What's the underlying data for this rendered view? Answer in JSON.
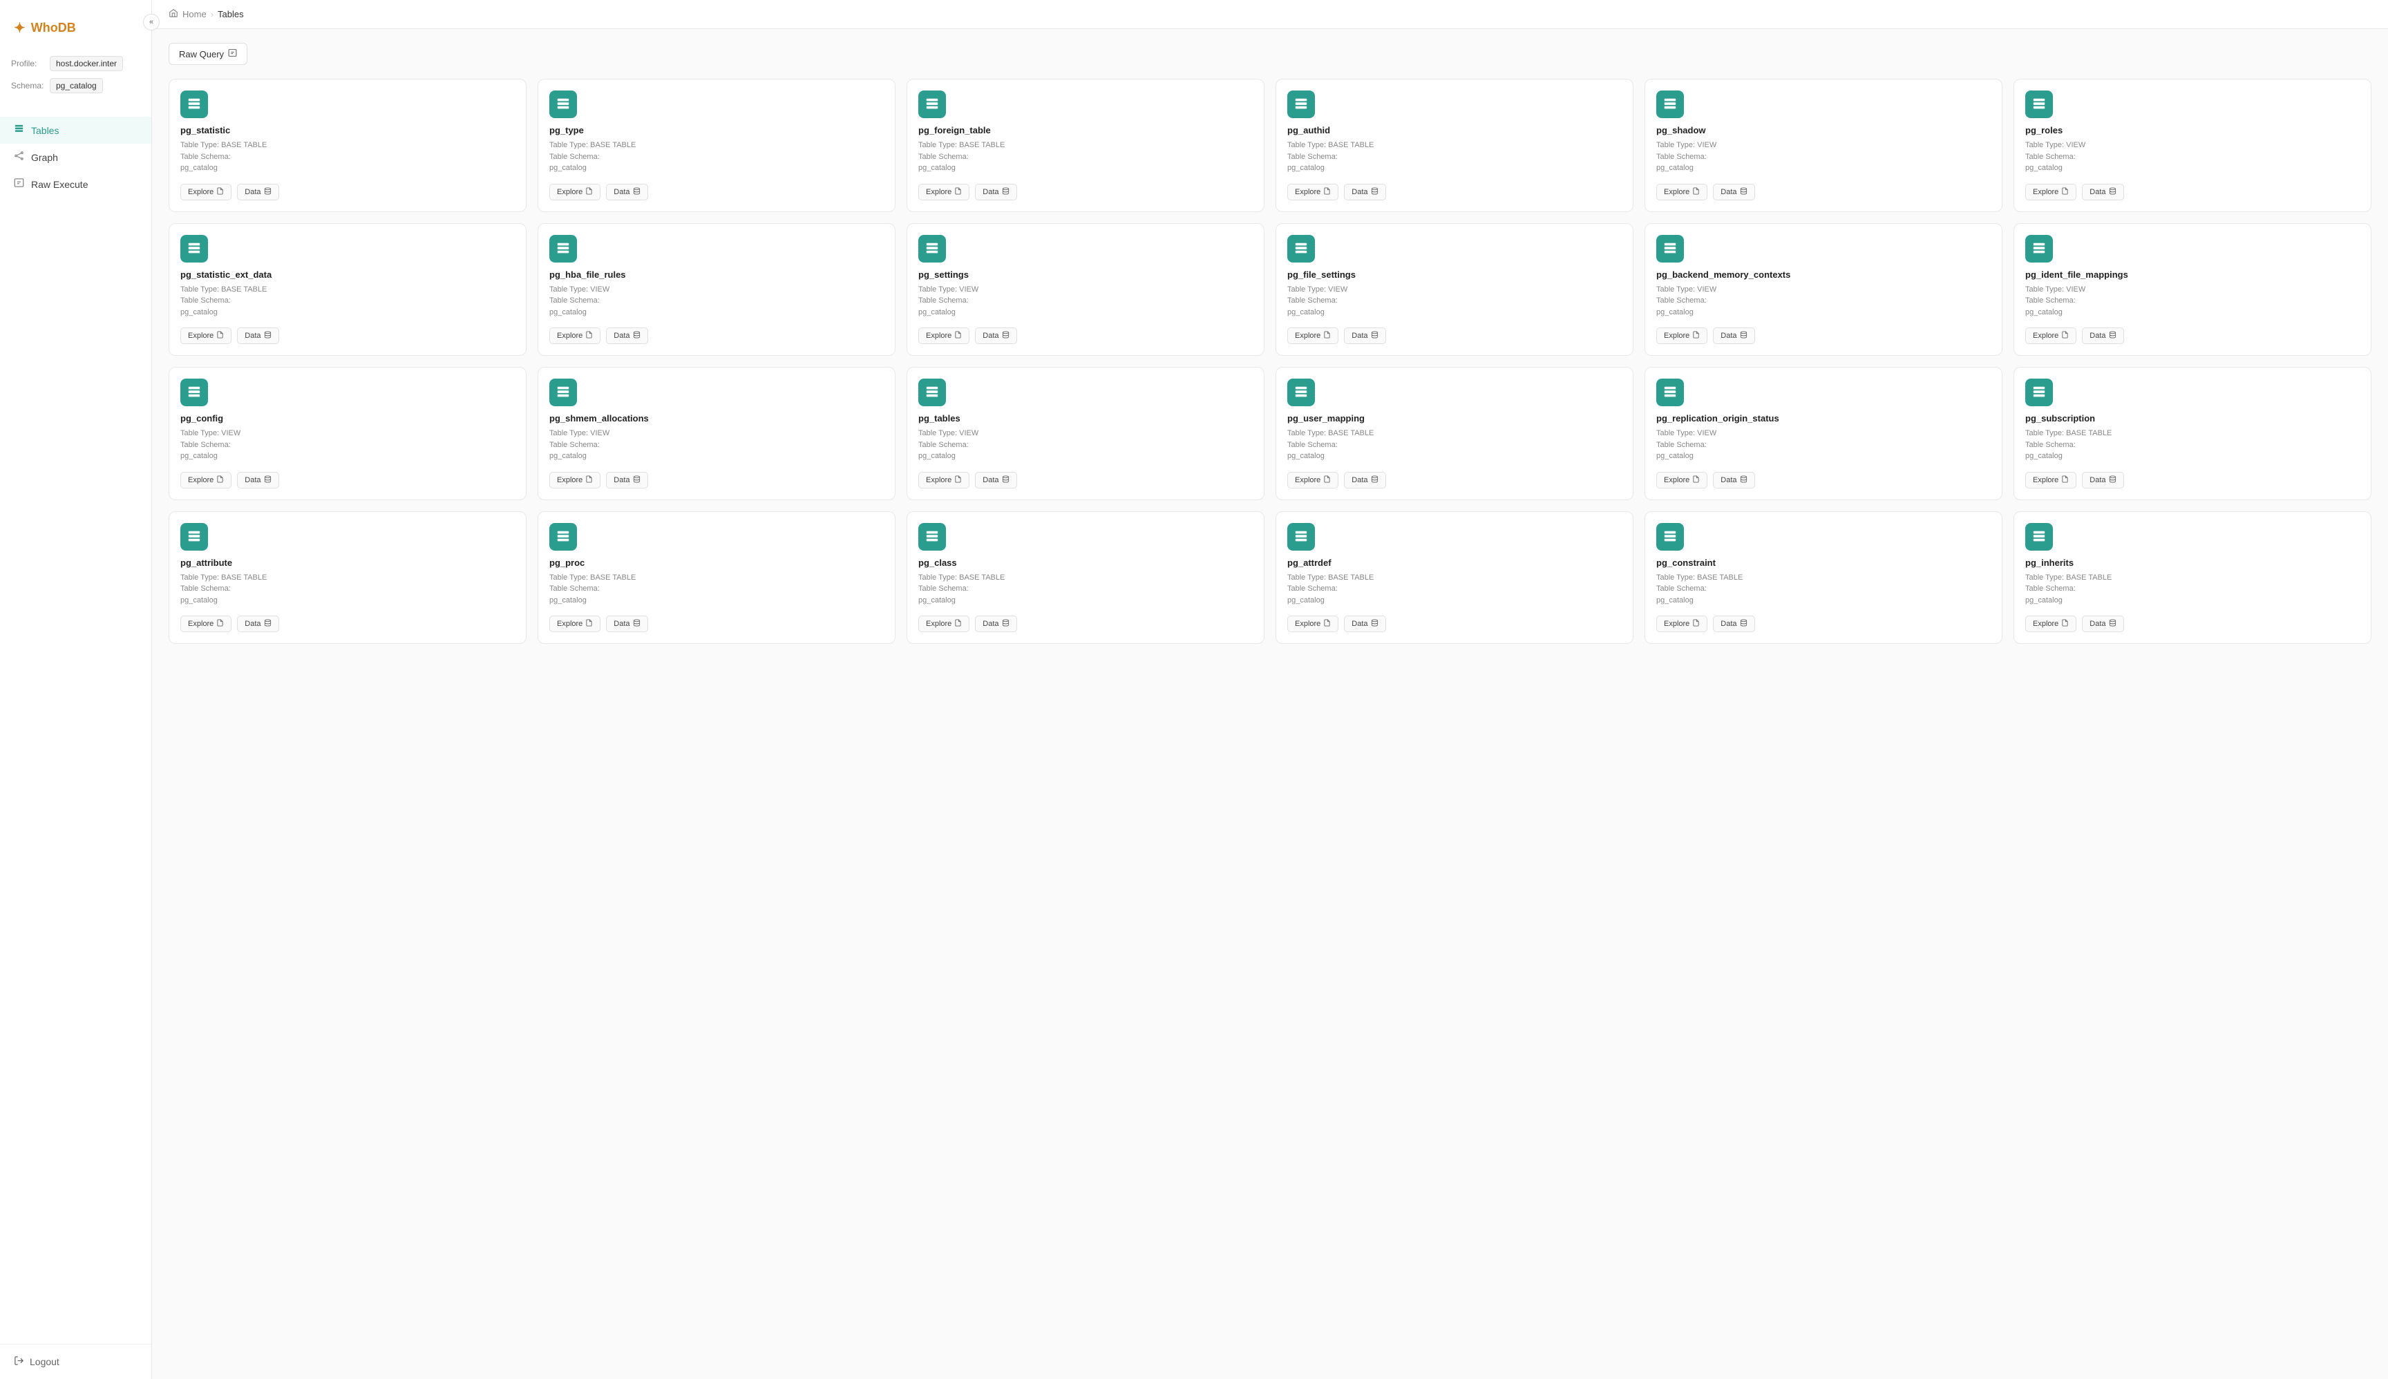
{
  "app": {
    "name": "WhoDB",
    "logo_icon": "✦"
  },
  "sidebar": {
    "profile_label": "Profile:",
    "profile_value": "host.docker.inter",
    "schema_label": "Schema:",
    "schema_value": "pg_catalog",
    "nav_items": [
      {
        "id": "tables",
        "label": "Tables",
        "icon": "table",
        "active": true
      },
      {
        "id": "graph",
        "label": "Graph",
        "icon": "graph",
        "active": false
      },
      {
        "id": "raw-execute",
        "label": "Raw Execute",
        "icon": "raw",
        "active": false
      }
    ],
    "logout_label": "Logout",
    "collapse_icon": "«"
  },
  "breadcrumb": {
    "home": "Home",
    "current": "Tables"
  },
  "toolbar": {
    "raw_query_label": "Raw Query"
  },
  "tables": [
    {
      "name": "pg_statistic",
      "type": "BASE TABLE",
      "schema": "pg_catalog"
    },
    {
      "name": "pg_type",
      "type": "BASE TABLE",
      "schema": "pg_catalog"
    },
    {
      "name": "pg_foreign_table",
      "type": "BASE TABLE",
      "schema": "pg_catalog"
    },
    {
      "name": "pg_authid",
      "type": "BASE TABLE",
      "schema": "pg_catalog"
    },
    {
      "name": "pg_shadow",
      "type": "VIEW",
      "schema": "pg_catalog"
    },
    {
      "name": "pg_roles",
      "type": "VIEW",
      "schema": "pg_catalog"
    },
    {
      "name": "pg_statistic_ext_data",
      "type": "BASE TABLE",
      "schema": "pg_catalog"
    },
    {
      "name": "pg_hba_file_rules",
      "type": "VIEW",
      "schema": "pg_catalog"
    },
    {
      "name": "pg_settings",
      "type": "VIEW",
      "schema": "pg_catalog"
    },
    {
      "name": "pg_file_settings",
      "type": "VIEW",
      "schema": "pg_catalog"
    },
    {
      "name": "pg_backend_memory_contexts",
      "type": "VIEW",
      "schema": "pg_catalog"
    },
    {
      "name": "pg_ident_file_mappings",
      "type": "VIEW",
      "schema": "pg_catalog"
    },
    {
      "name": "pg_config",
      "type": "VIEW",
      "schema": "pg_catalog"
    },
    {
      "name": "pg_shmem_allocations",
      "type": "VIEW",
      "schema": "pg_catalog"
    },
    {
      "name": "pg_tables",
      "type": "VIEW",
      "schema": "pg_catalog"
    },
    {
      "name": "pg_user_mapping",
      "type": "BASE TABLE",
      "schema": "pg_catalog"
    },
    {
      "name": "pg_replication_origin_status",
      "type": "VIEW",
      "schema": "pg_catalog"
    },
    {
      "name": "pg_subscription",
      "type": "BASE TABLE",
      "schema": "pg_catalog"
    },
    {
      "name": "pg_attribute",
      "type": "BASE TABLE",
      "schema": "pg_catalog"
    },
    {
      "name": "pg_proc",
      "type": "BASE TABLE",
      "schema": "pg_catalog"
    },
    {
      "name": "pg_class",
      "type": "BASE TABLE",
      "schema": "pg_catalog"
    },
    {
      "name": "pg_attrdef",
      "type": "BASE TABLE",
      "schema": "pg_catalog"
    },
    {
      "name": "pg_constraint",
      "type": "BASE TABLE",
      "schema": "pg_catalog"
    },
    {
      "name": "pg_inherits",
      "type": "BASE TABLE",
      "schema": "pg_catalog"
    }
  ],
  "card": {
    "explore_label": "Explore",
    "data_label": "Data",
    "type_prefix": "Table Type:",
    "schema_prefix": "Table Schema:"
  }
}
